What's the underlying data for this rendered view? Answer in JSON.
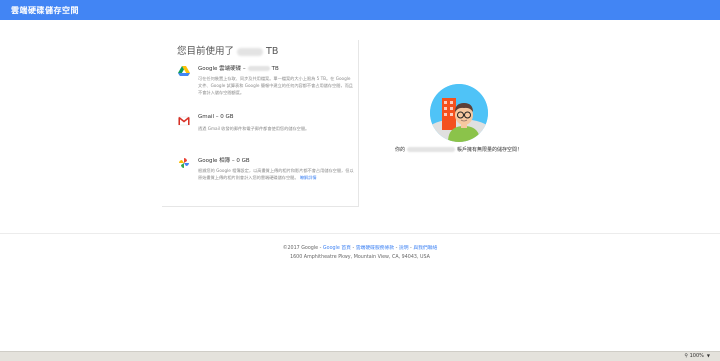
{
  "header": {
    "title": "雲端硬碟儲存空間"
  },
  "usage": {
    "prefix": "您目前使用了",
    "unit": "TB"
  },
  "services": [
    {
      "name": "Google 雲端硬碟 –",
      "suffix": "TB",
      "icon": "google-drive-icon",
      "description": "可在任何裝置上存取、同步及共用檔案。單一檔案的大小上限為 5 TB。在 Google 文件、Google 試算表和 Google 簡報中建立的任何內容都不會占用儲存空間，而且不會計入儲存空間額度。"
    },
    {
      "name": "Gmail – 0 GB",
      "icon": "gmail-icon",
      "description": "透過 Gmail 收發的郵件和電子郵件都會使用您的儲存空間。"
    },
    {
      "name": "Google 相簿 – 0 GB",
      "icon": "google-photos-icon",
      "description": "根據您的 Google 相簿設定，以高畫質上傳的相片和影片都不會占用儲存空間，但以原始畫質上傳的相片則會計入您的雲端硬碟儲存空間。",
      "link": "瞭解詳情"
    }
  ],
  "account": {
    "prefix": "你的",
    "suffix": "帳戶擁有無限量的儲存空間！",
    "illustration": "person-with-glasses-avatar"
  },
  "footer": {
    "copyright": "©2017 Google -",
    "links": [
      "Google 首頁",
      "雲端硬碟服務條款",
      "說明",
      "與我們聯絡"
    ],
    "separators": [
      " - ",
      " - ",
      " - "
    ],
    "address": "1600 Amphitheatre Pkwy, Mountain View, CA, 94043, USA"
  },
  "statusbar": {
    "zoom": "100%"
  },
  "colors": {
    "accent": "#4285f4",
    "link": "#4285f4"
  }
}
